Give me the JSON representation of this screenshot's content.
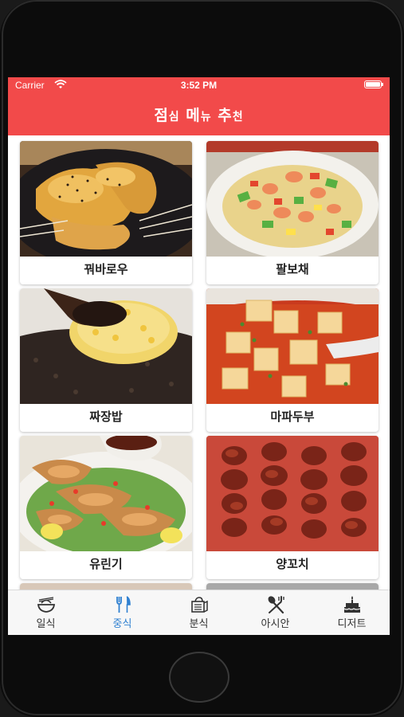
{
  "status_bar": {
    "carrier": "Carrier",
    "time": "3:52 PM"
  },
  "header": {
    "title_parts": [
      "점",
      "심",
      " 메",
      "뉴",
      " 추",
      "천"
    ]
  },
  "menu_items": [
    {
      "label": "꿔바로우"
    },
    {
      "label": "팔보채"
    },
    {
      "label": "짜장밥"
    },
    {
      "label": "마파두부"
    },
    {
      "label": "유린기"
    },
    {
      "label": "양꼬치"
    }
  ],
  "tabs": [
    {
      "label": "일식",
      "icon": "bowl-icon",
      "active": false
    },
    {
      "label": "중식",
      "icon": "fork-knife-icon",
      "active": true
    },
    {
      "label": "분식",
      "icon": "tray-icon",
      "active": false
    },
    {
      "label": "아시안",
      "icon": "utensils-cross-icon",
      "active": false
    },
    {
      "label": "디저트",
      "icon": "cake-icon",
      "active": false
    }
  ],
  "colors": {
    "header": "#f24a4a",
    "tab_active": "#2f80d1",
    "tab_inactive": "#333333"
  }
}
